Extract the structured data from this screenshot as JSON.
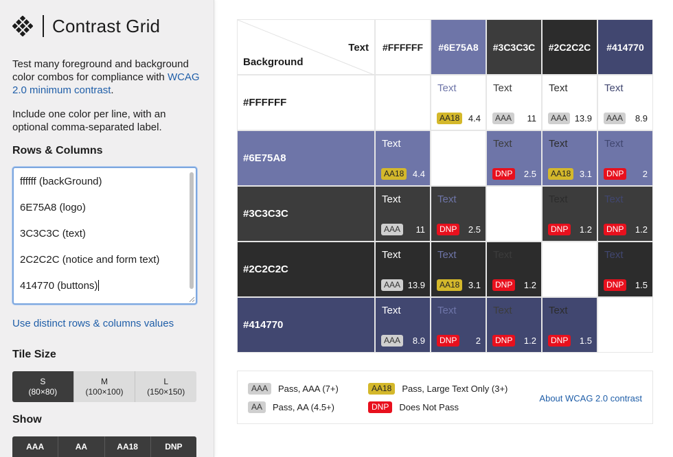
{
  "brand": {
    "title": "Contrast Grid",
    "logo_icon": "diamond-grid-logo-icon"
  },
  "intro": {
    "text_before": "Test many foreground and background color combos for compliance with",
    "link": "WCAG 2.0 minimum contrast",
    "text_after": ".",
    "instructions": "Include one color per line, with an optional comma-separated label."
  },
  "rows_columns": {
    "label": "Rows & Columns",
    "lines": [
      "ffffff  (backGround)",
      "6E75A8 (logo)",
      "3C3C3C (text)",
      "2C2C2C (notice and form text)",
      "414770 (buttons)"
    ],
    "distinct_link": "Use distinct rows & columns values"
  },
  "tile_size": {
    "label": "Tile Size",
    "options": [
      {
        "label": "S",
        "sub": "(80×80)",
        "active": true
      },
      {
        "label": "M",
        "sub": "(100×100)",
        "active": false
      },
      {
        "label": "L",
        "sub": "(150×150)",
        "active": false
      }
    ]
  },
  "show": {
    "label": "Show",
    "options": [
      "AAA",
      "AA",
      "AA18",
      "DNP"
    ]
  },
  "grid": {
    "corner_text": "Text",
    "corner_background": "Background",
    "sample_text": "Text",
    "colors": [
      {
        "label": "#FFFFFF",
        "hex": "#FFFFFF",
        "fg": "#1c1c1c"
      },
      {
        "label": "#6E75A8",
        "hex": "#6E75A8",
        "fg": "#ffffff"
      },
      {
        "label": "#3C3C3C",
        "hex": "#3C3C3C",
        "fg": "#ffffff"
      },
      {
        "label": "#2C2C2C",
        "hex": "#2C2C2C",
        "fg": "#ffffff"
      },
      {
        "label": "#414770",
        "hex": "#414770",
        "fg": "#ffffff"
      }
    ],
    "rows": [
      [
        null,
        {
          "badge": "AA18",
          "ratio": "4.4"
        },
        {
          "badge": "AAA",
          "ratio": "11"
        },
        {
          "badge": "AAA",
          "ratio": "13.9"
        },
        {
          "badge": "AAA",
          "ratio": "8.9"
        }
      ],
      [
        {
          "badge": "AA18",
          "ratio": "4.4"
        },
        null,
        {
          "badge": "DNP",
          "ratio": "2.5"
        },
        {
          "badge": "AA18",
          "ratio": "3.1"
        },
        {
          "badge": "DNP",
          "ratio": "2"
        }
      ],
      [
        {
          "badge": "AAA",
          "ratio": "11"
        },
        {
          "badge": "DNP",
          "ratio": "2.5"
        },
        null,
        {
          "badge": "DNP",
          "ratio": "1.2"
        },
        {
          "badge": "DNP",
          "ratio": "1.2"
        }
      ],
      [
        {
          "badge": "AAA",
          "ratio": "13.9"
        },
        {
          "badge": "AA18",
          "ratio": "3.1"
        },
        {
          "badge": "DNP",
          "ratio": "1.2"
        },
        null,
        {
          "badge": "DNP",
          "ratio": "1.5"
        }
      ],
      [
        {
          "badge": "AAA",
          "ratio": "8.9"
        },
        {
          "badge": "DNP",
          "ratio": "2"
        },
        {
          "badge": "DNP",
          "ratio": "1.2"
        },
        {
          "badge": "DNP",
          "ratio": "1.5"
        },
        null
      ]
    ]
  },
  "legend": {
    "items": [
      {
        "badge": "AAA",
        "text": "Pass, AAA (7+)"
      },
      {
        "badge": "AA",
        "text": "Pass, AA (4.5+)"
      },
      {
        "badge": "AA18",
        "text": "Pass, Large Text Only (3+)"
      },
      {
        "badge": "DNP",
        "text": "Does Not Pass"
      }
    ],
    "link": "About WCAG 2.0 contrast"
  }
}
